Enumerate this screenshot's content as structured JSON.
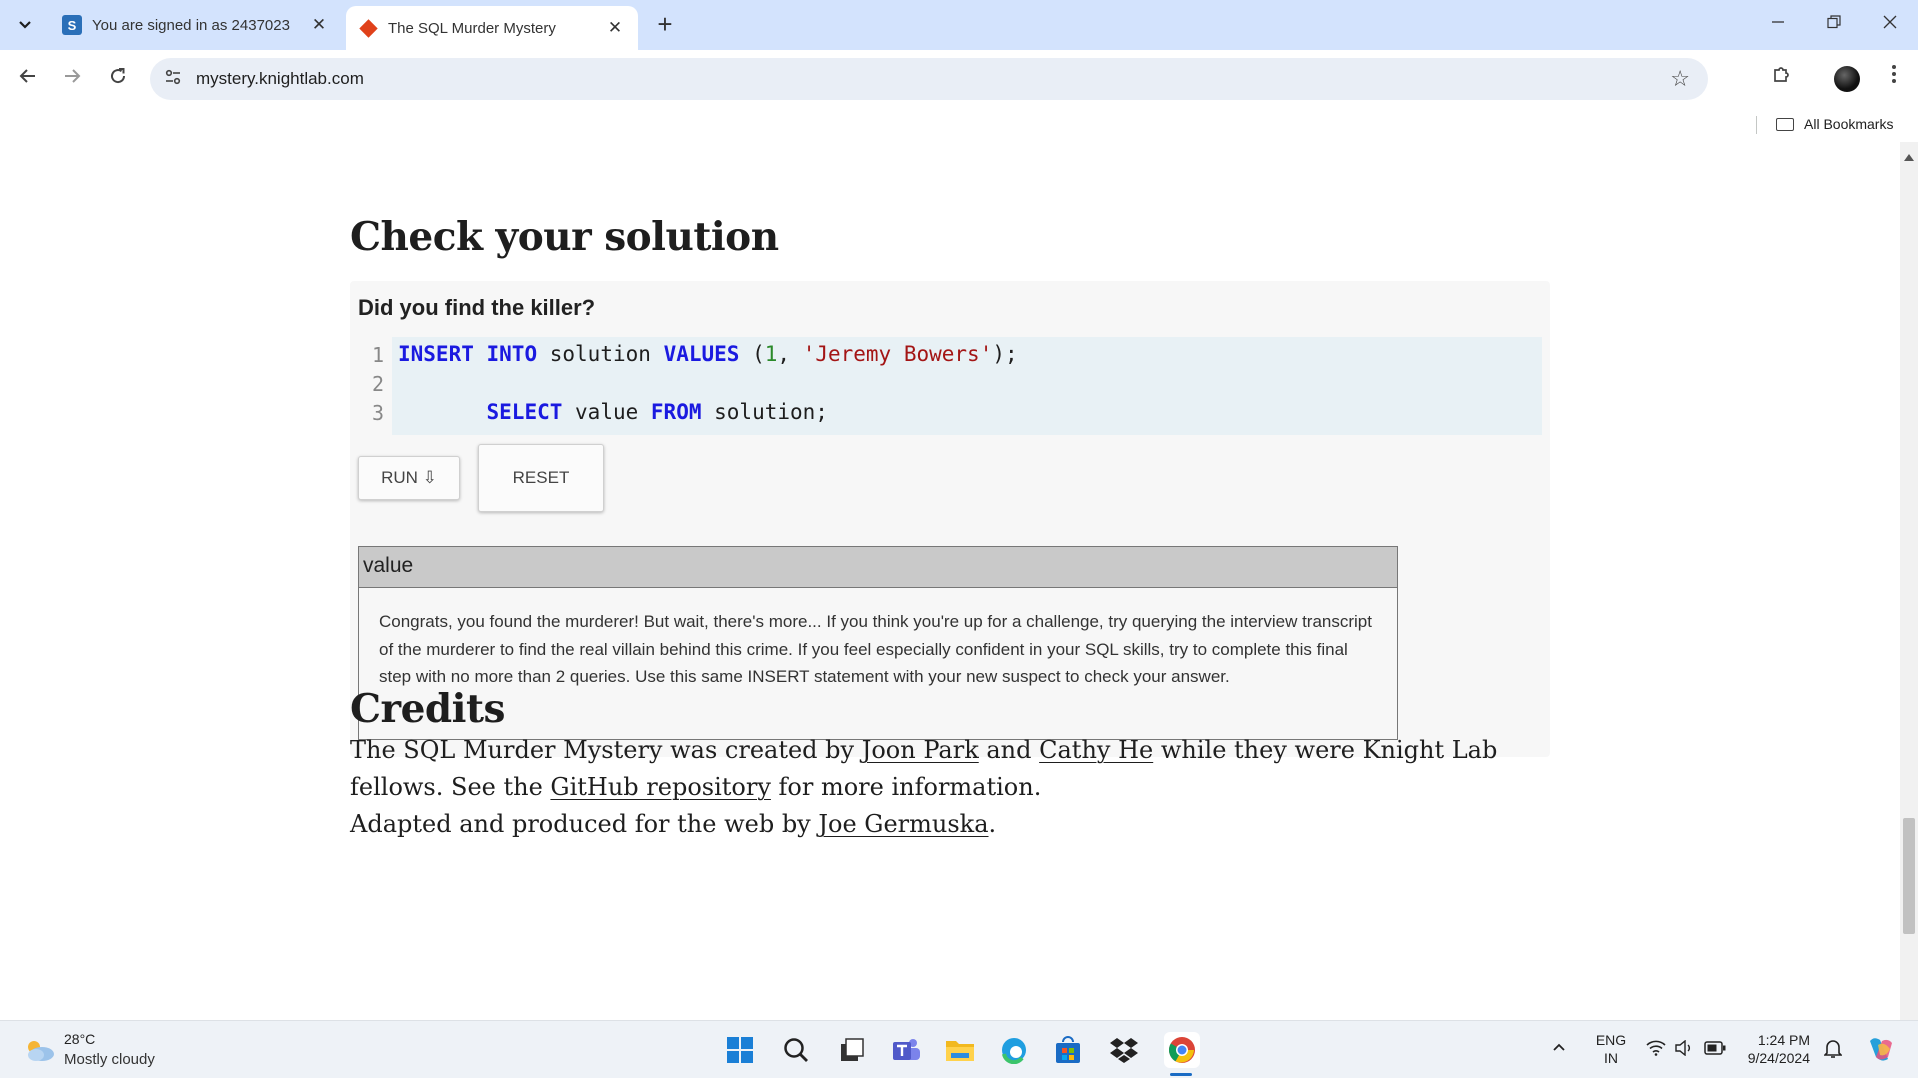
{
  "browser": {
    "tabs": [
      {
        "title": "You are signed in as 2437023",
        "favicon": "s-icon",
        "active": false
      },
      {
        "title": "The SQL Murder Mystery",
        "favicon": "diamond-icon",
        "active": true
      }
    ],
    "url": "mystery.knightlab.com",
    "bookmarks_label": "All Bookmarks"
  },
  "page": {
    "check_heading": "Check your solution",
    "question": "Did you find the killer?",
    "code_lines": [
      {
        "number": "1"
      },
      {
        "number": "2"
      },
      {
        "number": "3"
      }
    ],
    "code": {
      "line1": {
        "kw1": "INSERT",
        "kw2": "INTO",
        "t1": "solution",
        "kw3": "VALUES",
        "p1": "(",
        "n1": "1",
        "p2": ", ",
        "s1": "'Jeremy Bowers'",
        "p3": ");"
      },
      "line3": {
        "indent": "       ",
        "kw1": "SELECT",
        "t1": "value",
        "kw2": "FROM",
        "t2": "solution;"
      }
    },
    "run_label": "RUN ⇩",
    "reset_label": "RESET",
    "result_column": "value",
    "result_text": "Congrats, you found the murderer! But wait, there's more... If you think you're up for a challenge, try querying the interview transcript of the murderer to find the real villain behind this crime. If you feel especially confident in your SQL skills, try to complete this final step with no more than 2 queries. Use this same INSERT statement with your new suspect to check your answer.",
    "credits_heading": "Credits",
    "credits_p1": {
      "t1": "The SQL Murder Mystery was created by ",
      "link1": "Joon Park",
      "t2": " and ",
      "link2": "Cathy He",
      "t3": " while they were Knight Lab fellows. See the ",
      "link3": "GitHub repository",
      "t4": " for more information."
    },
    "credits_p2": {
      "t1": "Adapted and produced for the web by ",
      "link1": "Joe Germuska",
      "t2": "."
    }
  },
  "taskbar": {
    "temperature": "28°C",
    "weather": "Mostly cloudy",
    "lang_top": "ENG",
    "lang_bottom": "IN",
    "time": "1:24 PM",
    "date": "9/24/2024",
    "apps": [
      "windows-start-icon",
      "search-icon",
      "task-view-icon",
      "teams-icon",
      "file-explorer-icon",
      "edge-icon",
      "store-icon",
      "dropbox-icon",
      "chrome-icon"
    ]
  },
  "colors": {
    "tabstrip_bg": "#d3e3fd",
    "keyword": "#1a1ae0",
    "number": "#2a8a2a",
    "string": "#a31515",
    "editor_bg": "#e8f1f5"
  }
}
